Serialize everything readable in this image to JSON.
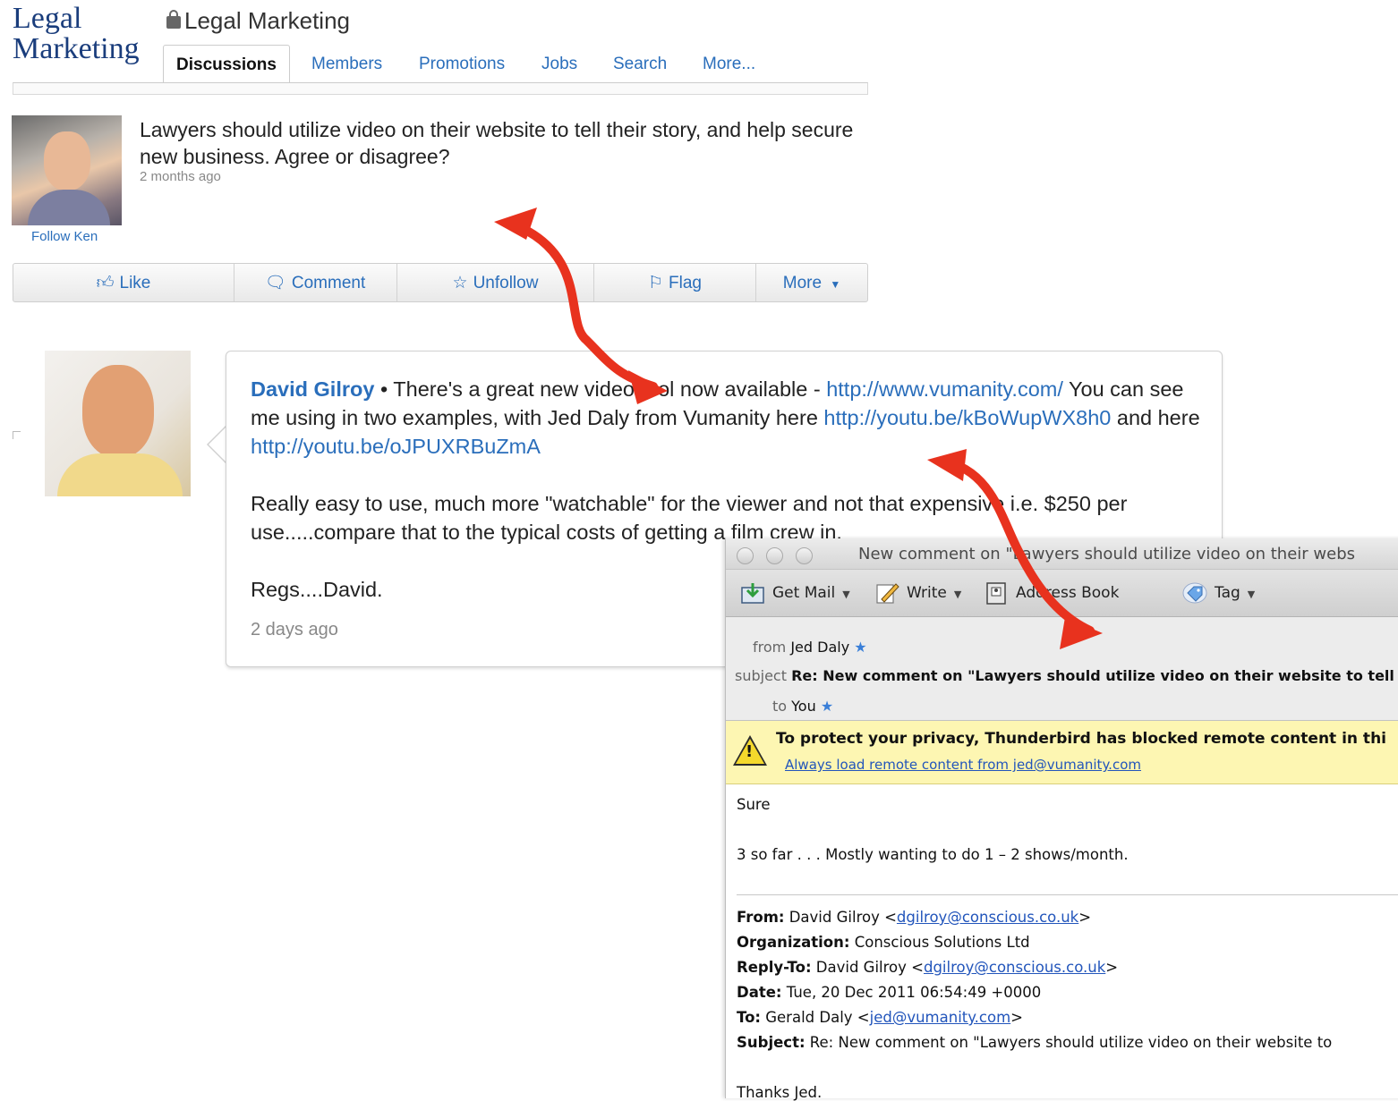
{
  "linkedin": {
    "logo_line1": "Legal",
    "logo_line2": "Marketing",
    "group_title": "Legal Marketing",
    "tabs": [
      "Discussions",
      "Members",
      "Promotions",
      "Jobs",
      "Search",
      "More..."
    ],
    "post": {
      "question": "Lawyers should utilize video on their website to tell their story, and help secure new business. Agree or disagree?",
      "time": "2 months ago",
      "follow": "Follow Ken"
    },
    "actions": [
      "Like",
      "Comment",
      "Unfollow",
      "Flag",
      "More"
    ]
  },
  "comment": {
    "author": "David Gilroy",
    "sep": " • There's a great new video tool now available - ",
    "link1": "http://www.vumanity.com/",
    "text2": " You can see me using in two examples, with Jed Daly from Vumanity here ",
    "link2": "http://youtu.be/kBoWupWX8h0",
    "text3": " and here ",
    "link3": "http://youtu.be/oJPUXRBuZmA",
    "para2": "Really easy to use, much more \"watchable\" for the viewer and not that expensive i.e. $250 per use.....compare that to the typical costs of getting a film crew in.",
    "para3": "Regs....David.",
    "time": "2 days ago"
  },
  "thunderbird": {
    "window_title": "New comment on \"Lawyers should utilize video on their webs",
    "toolbar": {
      "get_mail": "Get Mail",
      "write": "Write",
      "address_book": "Address Book",
      "tag": "Tag"
    },
    "header": {
      "from_label": "from",
      "from_value": "Jed Daly",
      "subject_label": "subject",
      "subject_value": "Re: New comment on \"Lawyers should utilize video on their website to tell t",
      "to_label": "to",
      "to_value": "You"
    },
    "notice": {
      "text": "To protect your privacy, Thunderbird has blocked remote content in thi",
      "link": "Always load remote content from jed@vumanity.com"
    },
    "body": {
      "line1": "Sure",
      "line2": "3 so far . . . Mostly wanting to do 1 – 2 shows/month.",
      "from_label": "From:",
      "from_name": " David Gilroy <",
      "from_email": "dgilroy@conscious.co.uk",
      "org_label": "Organization:",
      "org_value": " Conscious Solutions Ltd",
      "reply_label": "Reply-To:",
      "reply_name": " David Gilroy <",
      "reply_email": "dgilroy@conscious.co.uk",
      "date_label": "Date:",
      "date_value": " Tue, 20 Dec 2011 06:54:49 +0000",
      "to_label": "To:",
      "to_name": " Gerald Daly <",
      "to_email": "jed@vumanity.com",
      "subject_label": "Subject:",
      "subject_value": " Re: New comment on \"Lawyers should utilize video on their website to",
      "thanks": "Thanks Jed."
    }
  },
  "colors": {
    "link": "#2a6ebb",
    "arrow": "#e8321e",
    "notice_bg": "#fdf6b2"
  }
}
